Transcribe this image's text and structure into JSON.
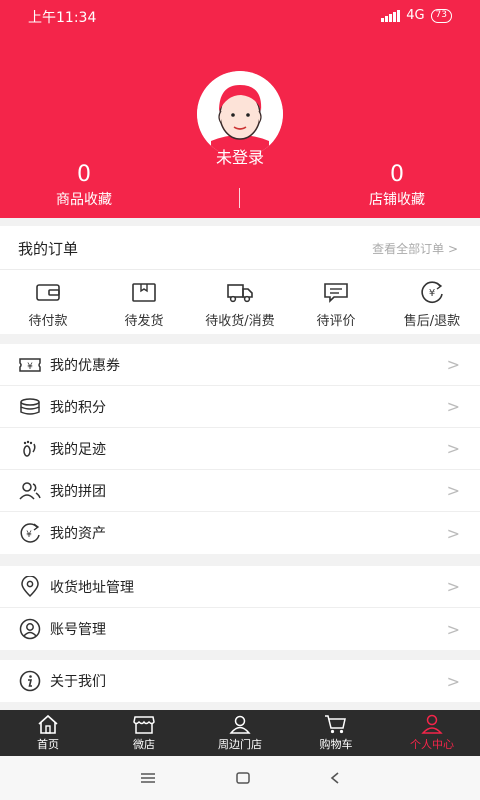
{
  "status_bar": {
    "time": "上午11:34",
    "network": "4G",
    "battery": "73"
  },
  "profile": {
    "login_text": "未登录"
  },
  "stats": [
    {
      "value": "0",
      "label": "商品收藏"
    },
    {
      "value": "0",
      "label": "店铺收藏"
    }
  ],
  "orders": {
    "title": "我的订单",
    "view_all": "查看全部订单 >",
    "items": [
      {
        "label": "待付款",
        "icon": "wallet-icon"
      },
      {
        "label": "待发货",
        "icon": "package-icon"
      },
      {
        "label": "待收货/消费",
        "icon": "truck-icon"
      },
      {
        "label": "待评价",
        "icon": "comment-icon"
      },
      {
        "label": "售后/退款",
        "icon": "refund-icon"
      }
    ]
  },
  "menu_group_1": [
    {
      "label": "我的优惠券",
      "icon": "coupon-icon"
    },
    {
      "label": "我的积分",
      "icon": "coins-icon"
    },
    {
      "label": "我的足迹",
      "icon": "footprint-icon"
    },
    {
      "label": "我的拼团",
      "icon": "group-icon"
    },
    {
      "label": "我的资产",
      "icon": "assets-icon"
    }
  ],
  "menu_group_2": [
    {
      "label": "收货地址管理",
      "icon": "location-icon"
    },
    {
      "label": "账号管理",
      "icon": "account-icon"
    }
  ],
  "menu_group_3": [
    {
      "label": "关于我们",
      "icon": "info-icon"
    }
  ],
  "arrow": ">",
  "tabs": [
    {
      "label": "首页",
      "icon": "home-icon"
    },
    {
      "label": "微店",
      "icon": "shop-icon"
    },
    {
      "label": "周边门店",
      "icon": "nearby-store-icon"
    },
    {
      "label": "购物车",
      "icon": "cart-icon"
    },
    {
      "label": "个人中心",
      "icon": "profile-icon",
      "active": true
    }
  ],
  "colors": {
    "brand": "#f4254a",
    "tabbar": "#2c2c2c"
  }
}
